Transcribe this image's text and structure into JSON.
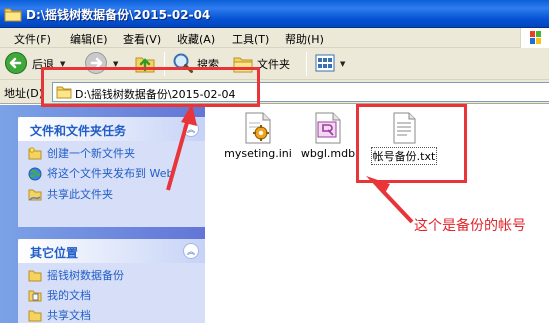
{
  "window": {
    "title": "D:\\摇钱树数据备份\\2015-02-04"
  },
  "menu": {
    "items": [
      "文件(F)",
      "编辑(E)",
      "查看(V)",
      "收藏(A)",
      "工具(T)",
      "帮助(H)"
    ]
  },
  "toolbar": {
    "back_label": "后退",
    "search_label": "搜索",
    "folders_label": "文件夹"
  },
  "address": {
    "label": "地址(D)",
    "path": "D:\\摇钱树数据备份\\2015-02-04"
  },
  "tasks": {
    "title": "文件和文件夹任务",
    "items": [
      "创建一个新文件夹",
      "将这个文件夹发布到 Web",
      "共享此文件夹"
    ]
  },
  "places": {
    "title": "其它位置",
    "items": [
      "摇钱树数据备份",
      "我的文档",
      "共享文档"
    ]
  },
  "files": [
    {
      "name": "myseting.ini",
      "icon": "ini-settings-icon"
    },
    {
      "name": "wbgl.mdb",
      "icon": "access-database-icon"
    },
    {
      "name": "帐号备份.txt",
      "icon": "text-file-icon"
    }
  ],
  "annotation": {
    "text": "这个是备份的帐号",
    "color": "#e0242b"
  },
  "colors": {
    "title_bar": "#0a5fd8",
    "task_pane": "#7ba2e7",
    "highlight": "#e8353a",
    "link": "#215dc6"
  }
}
